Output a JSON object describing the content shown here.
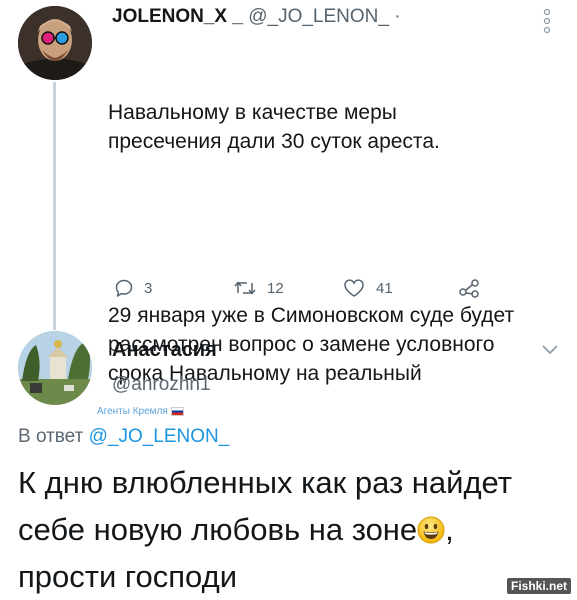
{
  "tweet1": {
    "display_name": "JOLENON_X _",
    "handle": "@_JO_LENON_",
    "separator": "·",
    "text_p1": "Навальному в качестве меры пресечения дали 30 суток ареста.",
    "text_p2": "29 января уже в Симоновском суде будет рассмотрен вопрос о замене условного срока Навальному на реальный",
    "actions": {
      "reply": {
        "icon": "reply-icon",
        "count": "3"
      },
      "retweet": {
        "icon": "retweet-icon",
        "count": "12"
      },
      "like": {
        "icon": "heart-icon",
        "count": "41"
      },
      "share": {
        "icon": "share-icon"
      }
    }
  },
  "tweet2": {
    "display_name": "Анастасия",
    "handle": "@anrozhn1",
    "badge": "Агенты Кремля",
    "reply_prefix": "В ответ",
    "reply_to": "@_JO_LENON_",
    "text_before_emoji": "К дню влюбленных как раз найдет себе новую любовь на зоне",
    "emoji": "grinning-face-emoji",
    "text_after_emoji": ", прости господи"
  },
  "watermark": "Fishki.net",
  "colors": {
    "text": "#14171a",
    "secondary": "#55636f",
    "link": "#1b95e0",
    "thread_line": "#c9d1d8"
  }
}
